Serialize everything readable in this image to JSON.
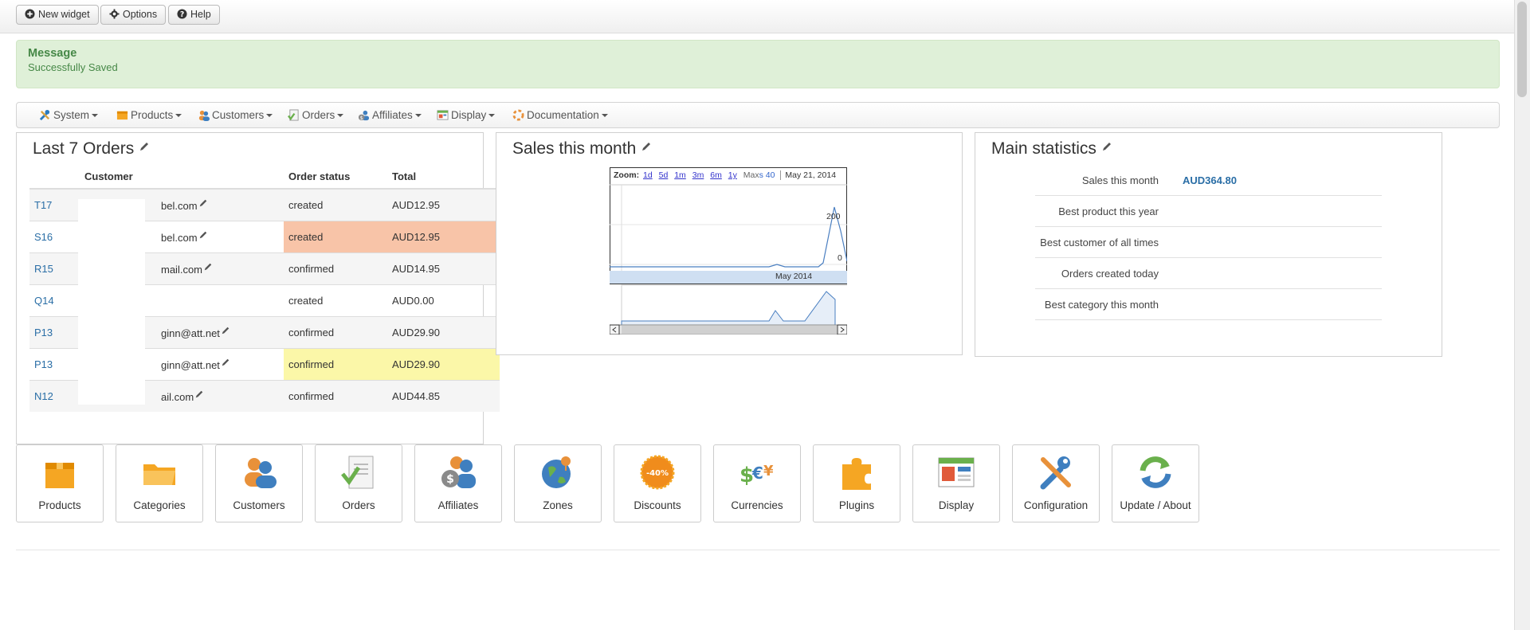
{
  "toolbar": {
    "new_widget": "New widget",
    "options": "Options",
    "help": "Help"
  },
  "alert": {
    "title": "Message",
    "text": "Successfully Saved"
  },
  "nav": {
    "items": [
      "System",
      "Products",
      "Customers",
      "Orders",
      "Affiliates",
      "Display",
      "Documentation"
    ]
  },
  "orders_widget": {
    "title": "Last 7 Orders",
    "columns": [
      "Customer",
      "Order status",
      "Total"
    ],
    "rows": [
      {
        "id": "T17",
        "customer": "bel.com",
        "status": "created",
        "total": "AUD12.95"
      },
      {
        "id": "S16",
        "customer": "bel.com",
        "status": "created",
        "total": "AUD12.95"
      },
      {
        "id": "R15",
        "customer": "mail.com",
        "status": "confirmed",
        "total": "AUD14.95"
      },
      {
        "id": "Q14",
        "customer": "",
        "status": "created",
        "total": "AUD0.00"
      },
      {
        "id": "P13",
        "customer": "ginn@att.net",
        "status": "confirmed",
        "total": "AUD29.90"
      },
      {
        "id": "P13",
        "customer": "ginn@att.net",
        "status": "confirmed",
        "total": "AUD29.90"
      },
      {
        "id": "N12",
        "customer": "ail.com",
        "status": "confirmed",
        "total": "AUD44.85"
      }
    ]
  },
  "sales_widget": {
    "title": "Sales this month",
    "zoom_label": "Zoom:",
    "zoom_options": [
      "1d",
      "5d",
      "1m",
      "3m",
      "6m",
      "1y"
    ],
    "max_label": "Max",
    "max_value": "s 40",
    "date": "May 21, 2014",
    "navigator_label": "May 2014",
    "y_ticks": [
      "200",
      "0"
    ]
  },
  "stats_widget": {
    "title": "Main statistics",
    "rows": [
      {
        "label": "Sales this month",
        "value": "AUD364.80"
      },
      {
        "label": "Best product this year",
        "value": ""
      },
      {
        "label": "Best customer of all times",
        "value": ""
      },
      {
        "label": "Orders created today",
        "value": ""
      },
      {
        "label": "Best category this month",
        "value": ""
      }
    ]
  },
  "tiles": [
    "Products",
    "Categories",
    "Customers",
    "Orders",
    "Affiliates",
    "Zones",
    "Discounts",
    "Currencies",
    "Plugins",
    "Display",
    "Configuration",
    "Update / About"
  ],
  "colors": {
    "link": "#2a6ea6",
    "alert_bg": "#dff0d8",
    "created_bg": "#f8c4a8",
    "confirmed_bg": "#fbf7a8"
  }
}
